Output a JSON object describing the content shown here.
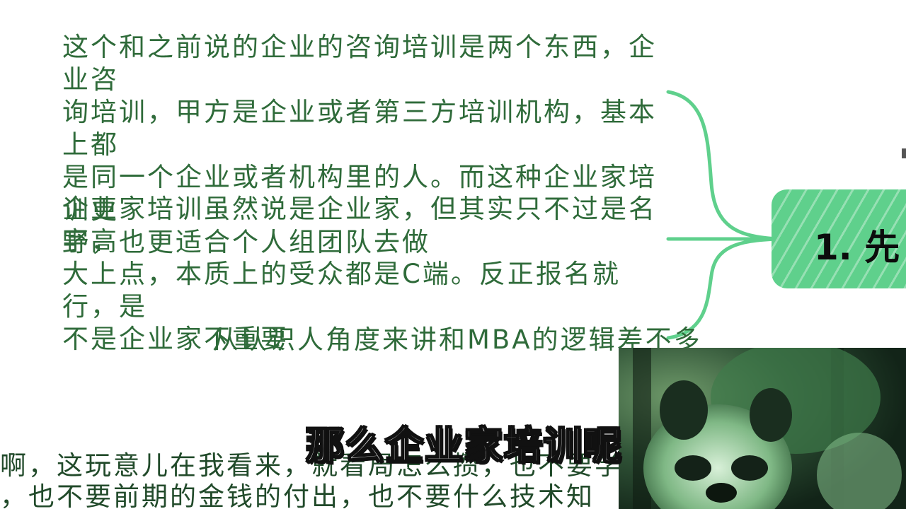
{
  "mindmap": {
    "notes": [
      "这个和之前说的企业的咨询培训是两个东西，企业咨\n询培训，甲方是企业或者第三方培训机构，基本上都\n是同一个企业或者机构里的人。而这种企业家培训更\n野，也更适合个人组团队去做",
      "企业家培训虽然说是企业家，但其实只不过是名字高\n大上点，本质上的受众都是C端。反正报名就行，是\n不是企业家不重要",
      "从认识人角度来讲和MBA的逻辑差不多"
    ],
    "node_label": "1. 先",
    "node_color": "#5fd08c",
    "text_color": "#2f6b3a"
  },
  "transcript": {
    "line1": "啊，这玩意儿在我看来，就看局怎么攒，也不要学",
    "line2": "，也不要前期的金钱的付出，也不要什么技术知"
  },
  "subtitle": "那么企业家培训呢"
}
